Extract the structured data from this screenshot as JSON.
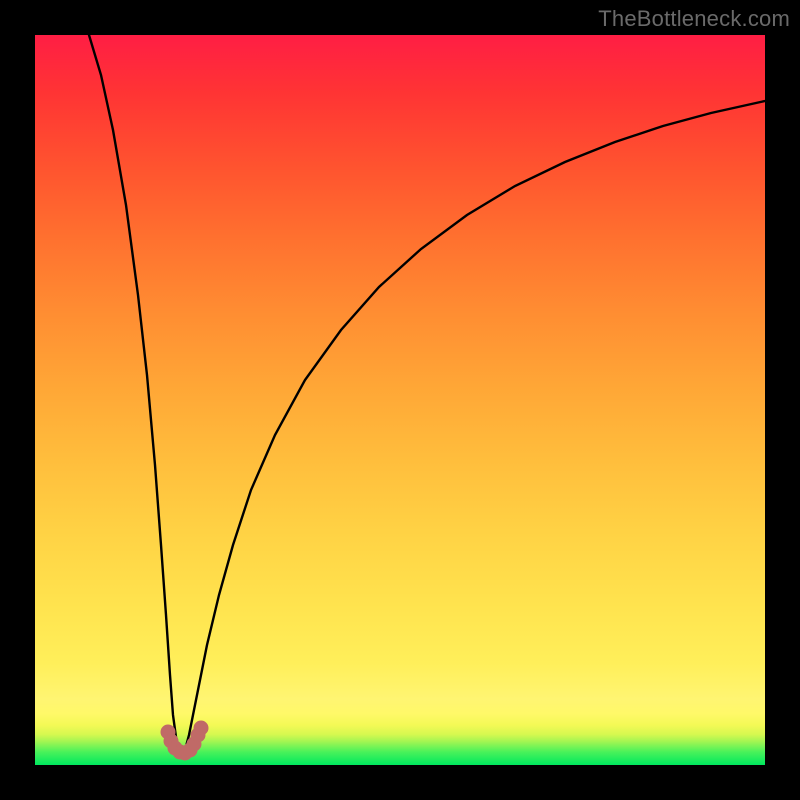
{
  "watermark": "TheBottleneck.com",
  "colors": {
    "frame": "#000000",
    "curve": "#000000",
    "marker": "#c06a67",
    "gradient_top": "#ff1e44",
    "gradient_bottom": "#00e85e"
  },
  "chart_data": {
    "type": "line",
    "title": "",
    "xlabel": "",
    "ylabel": "",
    "xlim": [
      0,
      100
    ],
    "ylim": [
      0,
      100
    ],
    "grid": false,
    "note": "absolute-value style bottleneck curve; minimum near x≈18; values estimated from pixels",
    "series": [
      {
        "name": "bottleneck-curve",
        "x": [
          0,
          2,
          4,
          6,
          8,
          10,
          12,
          14,
          15,
          16,
          17,
          18,
          19,
          20,
          21,
          22,
          24,
          26,
          28,
          30,
          34,
          38,
          42,
          46,
          50,
          55,
          60,
          65,
          70,
          75,
          80,
          85,
          90,
          95,
          100
        ],
        "y": [
          100,
          89,
          78,
          67,
          56,
          45,
          34,
          22,
          16,
          10,
          5,
          2.5,
          2,
          2.5,
          5,
          9,
          17,
          26,
          33,
          39,
          49,
          57,
          63,
          68,
          72,
          76,
          79.5,
          82.5,
          85,
          87,
          88.8,
          90.2,
          91.4,
          92.4,
          93.2
        ]
      }
    ],
    "markers": [
      {
        "x": 17.5,
        "y": 2.5
      },
      {
        "x": 19.8,
        "y": 2.6
      }
    ],
    "marker_cluster_path": "dense salmon U-shaped cluster at trough"
  }
}
